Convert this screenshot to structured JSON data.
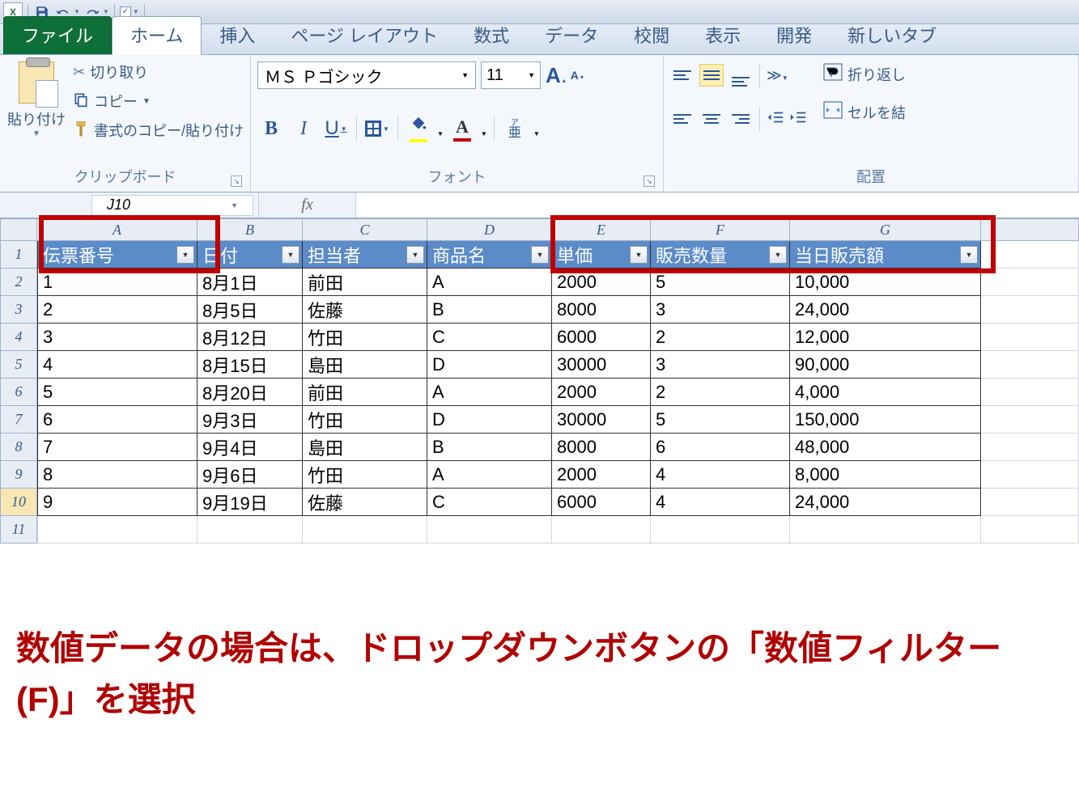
{
  "qat": {
    "save": "save",
    "undo": "undo",
    "redo": "redo"
  },
  "tabs": {
    "file": "ファイル",
    "home": "ホーム",
    "insert": "挿入",
    "layout": "ページ レイアウト",
    "formula": "数式",
    "data": "データ",
    "review": "校閲",
    "view": "表示",
    "dev": "開発",
    "new": "新しいタブ"
  },
  "clipboard": {
    "paste": "貼り付け",
    "cut": "切り取り",
    "copy": "コピー",
    "format": "書式のコピー/貼り付け",
    "group": "クリップボード"
  },
  "font": {
    "name": "ＭＳ Ｐゴシック",
    "size": "11",
    "group": "フォント",
    "b": "B",
    "i": "I",
    "u": "U",
    "phon_rt": "ア",
    "phon_base": "亜"
  },
  "align": {
    "group": "配置",
    "wrap": "折り返し",
    "merge": "セルを結"
  },
  "namebox": "J10",
  "columns": [
    "A",
    "B",
    "C",
    "D",
    "E",
    "F",
    "G"
  ],
  "headers": [
    "伝票番号",
    "日付",
    "担当者",
    "商品名",
    "単価",
    "販売数量",
    "当日販売額"
  ],
  "rows": [
    {
      "n": "1",
      "d": "8月1日",
      "p": "前田",
      "g": "A",
      "u": "2000",
      "q": "5",
      "t": "10,000"
    },
    {
      "n": "2",
      "d": "8月5日",
      "p": "佐藤",
      "g": "B",
      "u": "8000",
      "q": "3",
      "t": "24,000"
    },
    {
      "n": "3",
      "d": "8月12日",
      "p": "竹田",
      "g": "C",
      "u": "6000",
      "q": "2",
      "t": "12,000"
    },
    {
      "n": "4",
      "d": "8月15日",
      "p": "島田",
      "g": "D",
      "u": "30000",
      "q": "3",
      "t": "90,000"
    },
    {
      "n": "5",
      "d": "8月20日",
      "p": "前田",
      "g": "A",
      "u": "2000",
      "q": "2",
      "t": "4,000"
    },
    {
      "n": "6",
      "d": "9月3日",
      "p": "竹田",
      "g": "D",
      "u": "30000",
      "q": "5",
      "t": "150,000"
    },
    {
      "n": "7",
      "d": "9月4日",
      "p": "島田",
      "g": "B",
      "u": "8000",
      "q": "6",
      "t": "48,000"
    },
    {
      "n": "8",
      "d": "9月6日",
      "p": "竹田",
      "g": "A",
      "u": "2000",
      "q": "4",
      "t": "8,000"
    },
    {
      "n": "9",
      "d": "9月19日",
      "p": "佐藤",
      "g": "C",
      "u": "6000",
      "q": "4",
      "t": "24,000"
    }
  ],
  "annotation": "数値データの場合は、ドロップダウンボタンの「数値フィルター (F)」を選択"
}
